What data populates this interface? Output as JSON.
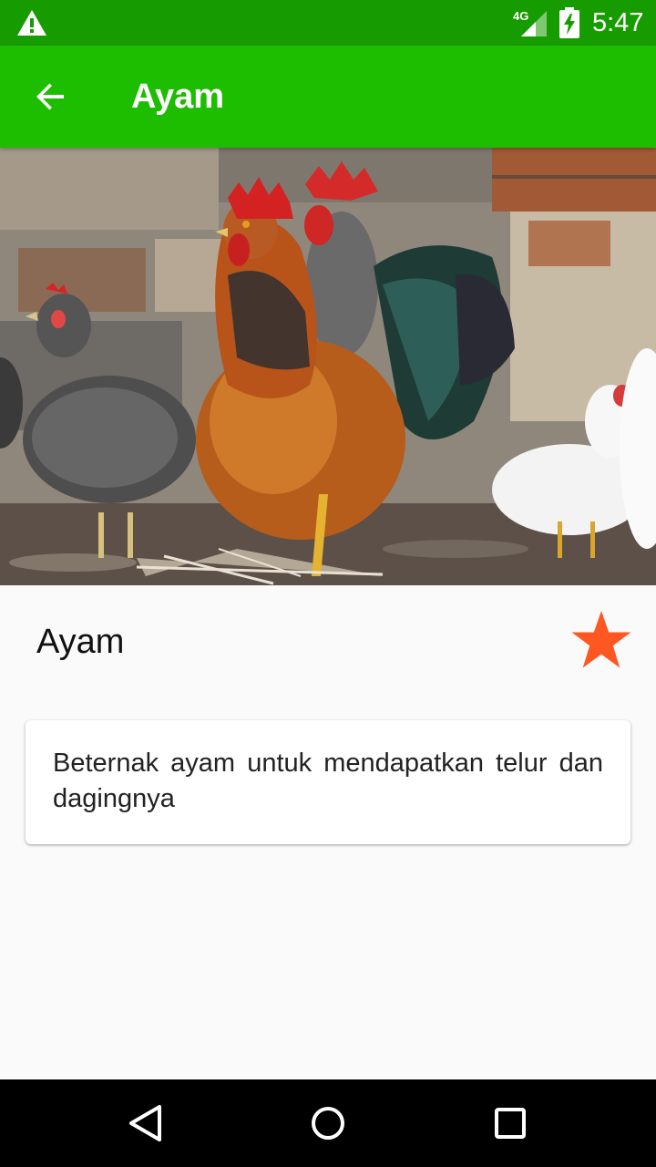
{
  "status_bar": {
    "time": "5:47",
    "network": "4G",
    "icons": [
      "warning-icon",
      "signal-4g-icon",
      "battery-charging-icon"
    ]
  },
  "app_bar": {
    "title": "Ayam",
    "back_icon": "arrow-left-icon"
  },
  "hero": {
    "subject": "chickens"
  },
  "detail": {
    "title": "Ayam",
    "favorite_icon": "star-icon",
    "description": "Beternak ayam untuk mendapatkan telur dan dagingnya"
  },
  "nav_bar": {
    "icons": [
      "nav-back-icon",
      "nav-home-icon",
      "nav-recent-icon"
    ]
  },
  "colors": {
    "status_bar": "#179c00",
    "app_bar": "#1dbd00",
    "accent_star": "#ff5722",
    "background": "#fafafa"
  }
}
